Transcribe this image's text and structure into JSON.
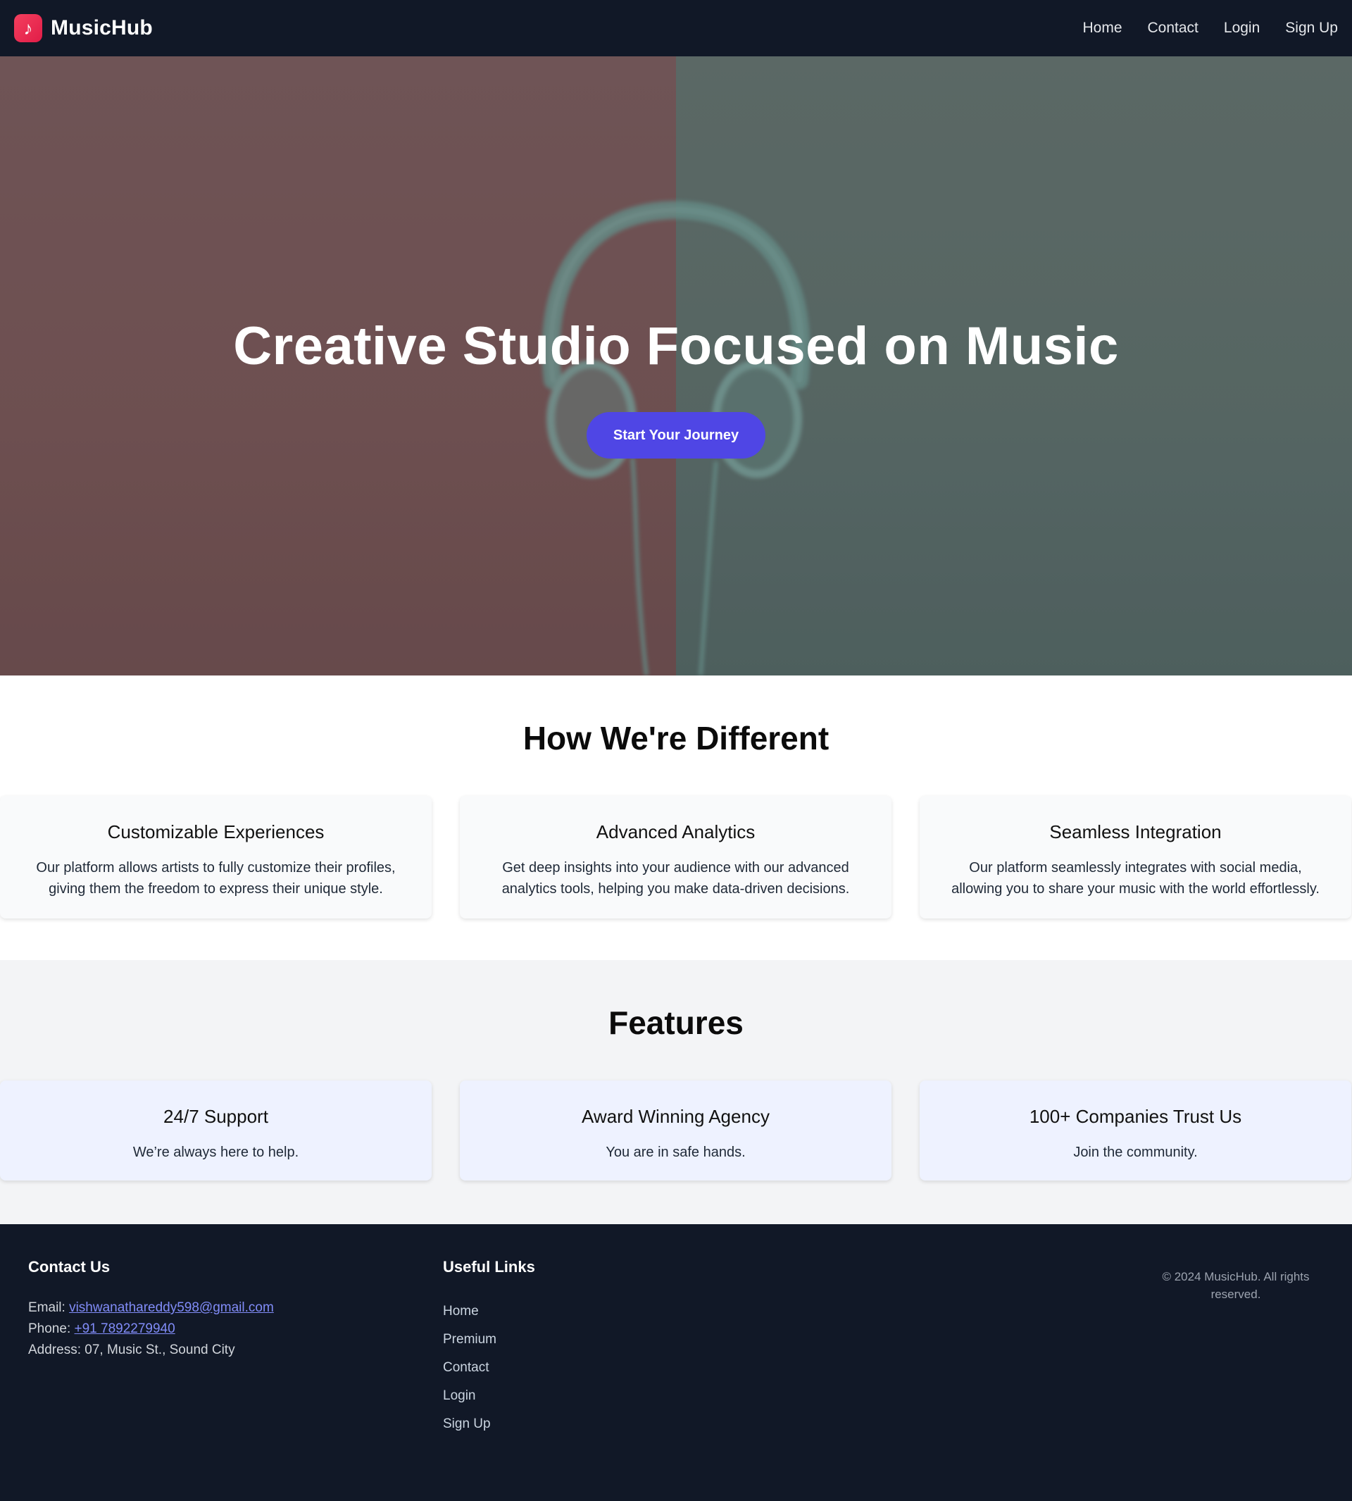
{
  "header": {
    "logo_icon": "music-note-icon",
    "brand": "MusicHub",
    "nav": [
      "Home",
      "Contact",
      "Login",
      "Sign Up"
    ]
  },
  "hero": {
    "title": "Creative Studio Focused on Music",
    "cta": "Start Your Journey",
    "colors": {
      "left": "#7d5e5e",
      "right": "#66756f",
      "cta": "#4f46e5"
    }
  },
  "different": {
    "title": "How We're Different",
    "cards": [
      {
        "title": "Customizable Experiences",
        "desc": "Our platform allows artists to fully customize their profiles, giving them the freedom to express their unique style."
      },
      {
        "title": "Advanced Analytics",
        "desc": "Get deep insights into your audience with our advanced analytics tools, helping you make data-driven decisions."
      },
      {
        "title": "Seamless Integration",
        "desc": "Our platform seamlessly integrates with social media, allowing you to share your music with the world effortlessly."
      }
    ]
  },
  "features": {
    "title": "Features",
    "cards": [
      {
        "title": "24/7 Support",
        "desc": "We’re always here to help."
      },
      {
        "title": "Award Winning Agency",
        "desc": "You are in safe hands."
      },
      {
        "title": "100+ Companies Trust Us",
        "desc": "Join the community."
      }
    ]
  },
  "footer": {
    "contact_heading": "Contact Us",
    "email_label": "Email:",
    "email": "vishwanathareddy598@gmail.com",
    "phone_label": "Phone:",
    "phone": "+91 7892279940",
    "address": "Address: 07, Music St., Sound City",
    "links_heading": "Useful Links",
    "links": [
      "Home",
      "Premium",
      "Contact",
      "Login",
      "Sign Up"
    ],
    "copyright_line1": "© 2024 MusicHub. All rights",
    "copyright_line2": "reserved."
  }
}
